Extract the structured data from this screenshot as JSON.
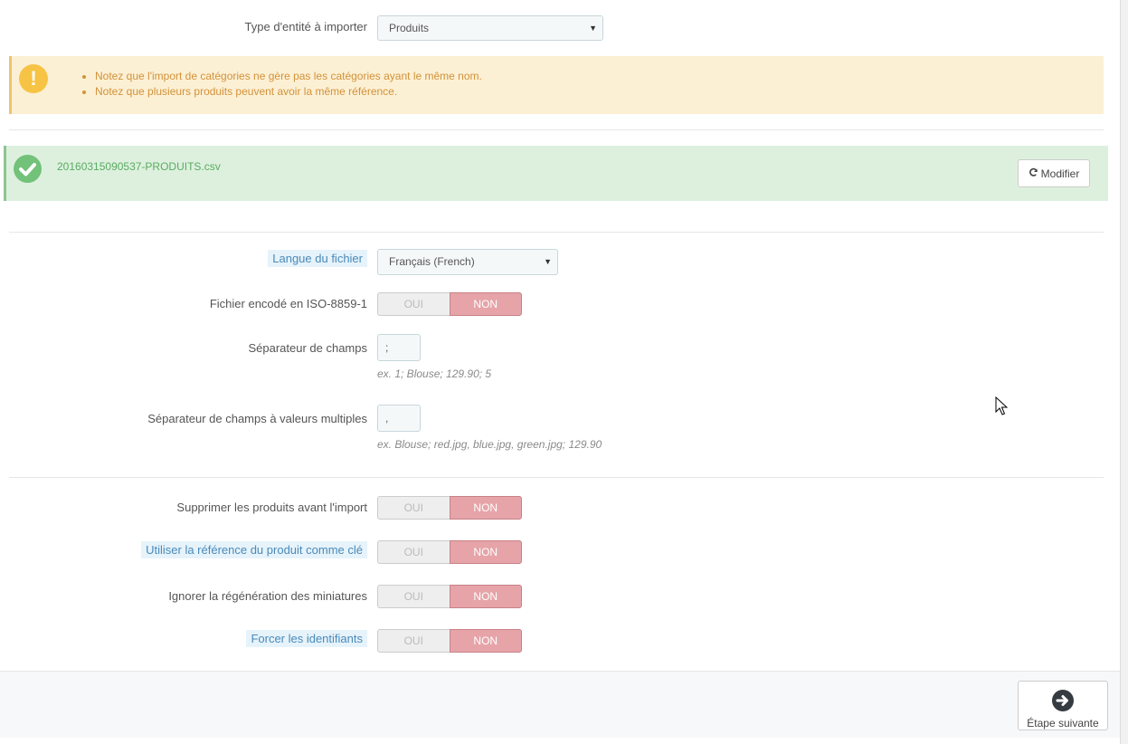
{
  "entity_type": {
    "label": "Type d'entité à importer",
    "value": "Produits"
  },
  "warning": {
    "items": [
      "Notez que l'import de catégories ne gère pas les catégories ayant le même nom.",
      "Notez que plusieurs produits peuvent avoir la même référence."
    ]
  },
  "file": {
    "name": "20160315090537-PRODUITS.csv",
    "modify_label": "Modifier"
  },
  "file_language": {
    "label": "Langue du fichier",
    "value": "Français (French)"
  },
  "iso_encoding": {
    "label": "Fichier encodé en ISO-8859-1",
    "yes": "OUI",
    "no": "NON"
  },
  "field_separator": {
    "label": "Séparateur de champs",
    "value": ";",
    "help": "ex. 1; Blouse; 129.90; 5"
  },
  "multi_separator": {
    "label": "Séparateur de champs à valeurs multiples",
    "value": ",",
    "help": "ex. Blouse; red.jpg, blue.jpg, green.jpg; 129.90"
  },
  "delete_products": {
    "label": "Supprimer les produits avant l'import",
    "yes": "OUI",
    "no": "NON"
  },
  "use_reference": {
    "label": "Utiliser la référence du produit comme clé",
    "yes": "OUI",
    "no": "NON"
  },
  "skip_thumbnails": {
    "label": "Ignorer la régénération des miniatures",
    "yes": "OUI",
    "no": "NON"
  },
  "force_ids": {
    "label": "Forcer les identifiants",
    "yes": "OUI",
    "no": "NON"
  },
  "next_step": {
    "label": "Étape suivante"
  },
  "colors": {
    "warning_bg": "#fcf0d4",
    "success_bg": "#ddf0de",
    "switch_no": "#e6a4a9"
  }
}
